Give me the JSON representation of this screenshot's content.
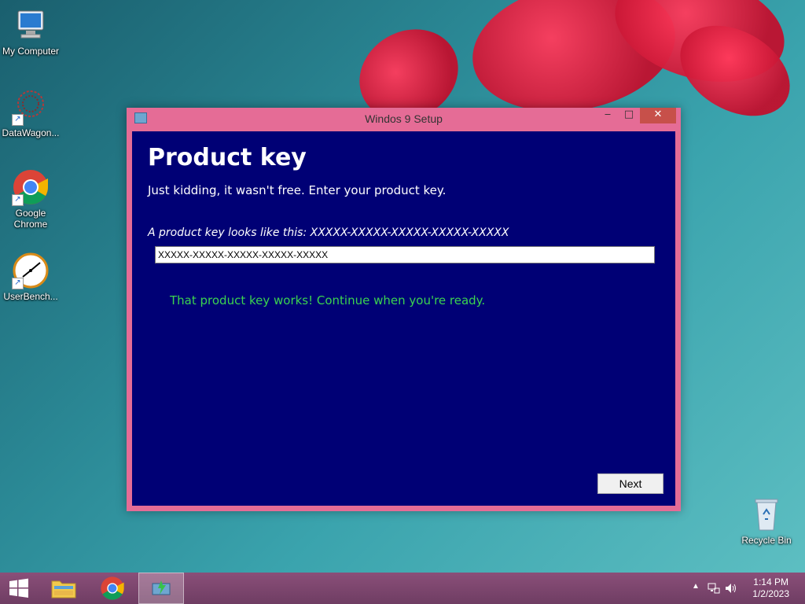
{
  "desktop": {
    "icons": [
      {
        "label": "My Computer",
        "icon": "computer-icon"
      },
      {
        "label": "DataWagon...",
        "icon": "datawagon-icon"
      },
      {
        "label": "Google Chrome",
        "icon": "chrome-icon"
      },
      {
        "label": "UserBench...",
        "icon": "userbenchmark-icon"
      },
      {
        "label": "Recycle Bin",
        "icon": "recycle-bin-icon"
      }
    ]
  },
  "window": {
    "title": "Windos 9 Setup",
    "heading": "Product key",
    "subtitle": "Just kidding, it wasn't free. Enter your product key.",
    "hint": "A product key looks like this: XXXXX-XXXXX-XXXXX-XXXXX-XXXXX",
    "key_value": "XXXXX-XXXXX-XXXXX-XXXXX-XXXXX",
    "success_message": "That product key works! Continue when you're ready.",
    "next_label": "Next",
    "controls": {
      "minimize": "‒",
      "maximize": "□",
      "close": "✕"
    }
  },
  "taskbar": {
    "items": [
      "start-button",
      "file-explorer",
      "chrome",
      "setup-app"
    ],
    "active_item": "setup-app",
    "clock": {
      "time": "1:14 PM",
      "date": "1/2/2023"
    }
  },
  "colors": {
    "window_frame": "#e56c96",
    "client_bg": "#000075",
    "success_text": "#3bd34f",
    "taskbar": "#7a4570"
  }
}
